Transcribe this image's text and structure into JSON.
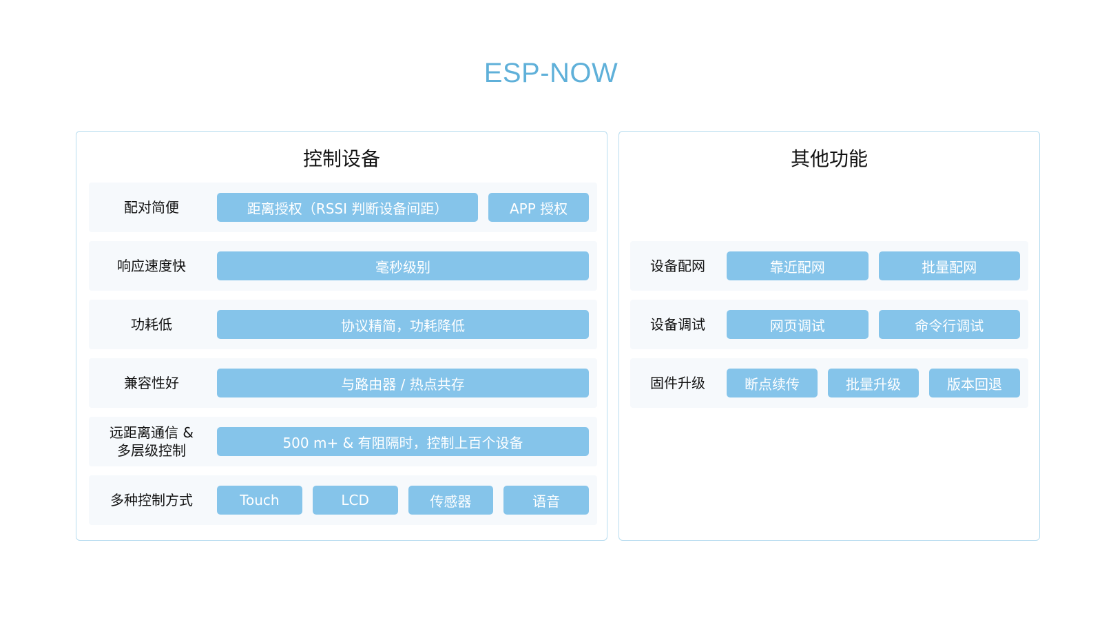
{
  "title": "ESP-NOW",
  "left_panel": {
    "heading": "控制设备",
    "rows": [
      {
        "label": "配对简便",
        "chips": [
          "距离授权（RSSI 判断设备间距）",
          "APP 授权"
        ]
      },
      {
        "label": "响应速度快",
        "chips": [
          "毫秒级别"
        ]
      },
      {
        "label": "功耗低",
        "chips": [
          "协议精简，功耗降低"
        ]
      },
      {
        "label": "兼容性好",
        "chips": [
          "与路由器 / 热点共存"
        ]
      },
      {
        "label_line1": "远距离通信 &",
        "label_line2": "多层级控制",
        "chips": [
          "500 m+ & 有阻隔时，控制上百个设备"
        ]
      },
      {
        "label": "多种控制方式",
        "chips": [
          "Touch",
          "LCD",
          "传感器",
          "语音"
        ]
      }
    ]
  },
  "right_panel": {
    "heading": "其他功能",
    "rows": [
      {
        "label": "设备配网",
        "chips": [
          "靠近配网",
          "批量配网"
        ]
      },
      {
        "label": "设备调试",
        "chips": [
          "网页调试",
          "命令行调试"
        ]
      },
      {
        "label": "固件升级",
        "chips": [
          "断点续传",
          "批量升级",
          "版本回退"
        ]
      }
    ]
  },
  "colors": {
    "title": "#5fb0d9",
    "chip": "#85c4ea",
    "panel_border": "#b7dcef",
    "row_background": "#f6f9fc"
  }
}
